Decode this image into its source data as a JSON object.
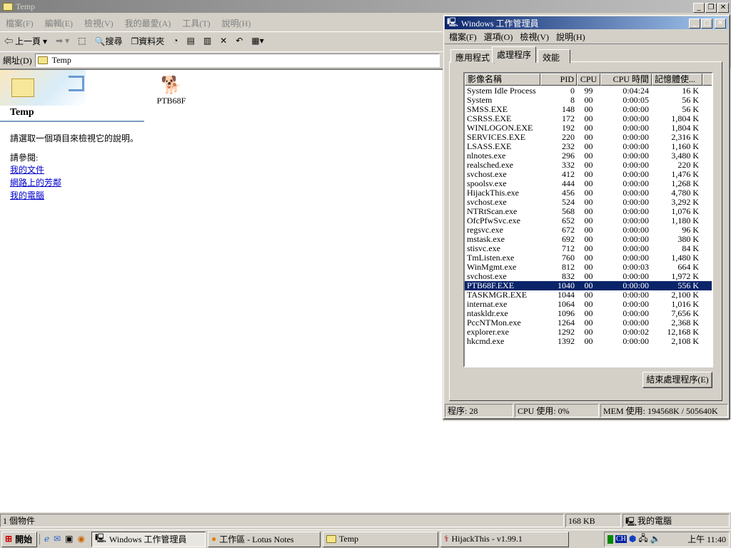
{
  "explorer": {
    "title": "Temp",
    "menu": [
      "檔案(F)",
      "編輯(E)",
      "檢視(V)",
      "我的最愛(A)",
      "工具(T)",
      "說明(H)"
    ],
    "toolbar": {
      "back": "上一頁",
      "search": "搜尋",
      "folders": "資料夾"
    },
    "address": {
      "label": "網址(D)",
      "value": "Temp"
    },
    "side": {
      "title": "Temp",
      "hint": "請選取一個項目來檢視它的說明。",
      "see_also": "請參閱:",
      "links": [
        "我的文件",
        "網路上的芳鄰",
        "我的電腦"
      ]
    },
    "file": {
      "name": "PTB68F"
    },
    "status": {
      "count": "1 個物件",
      "size": "168 KB",
      "zone": "我的電腦"
    }
  },
  "taskmgr": {
    "title": "Windows 工作管理員",
    "menu": [
      "檔案(F)",
      "選項(O)",
      "檢視(V)",
      "說明(H)"
    ],
    "tabs": [
      "應用程式",
      "處理程序",
      "效能"
    ],
    "columns": [
      "影像名稱",
      "PID",
      "CPU",
      "CPU 時間",
      "記憶體使..."
    ],
    "processes": [
      [
        "System Idle Process",
        "0",
        "99",
        "0:04:24",
        "16 K"
      ],
      [
        "System",
        "8",
        "00",
        "0:00:05",
        "56 K"
      ],
      [
        "SMSS.EXE",
        "148",
        "00",
        "0:00:00",
        "56 K"
      ],
      [
        "CSRSS.EXE",
        "172",
        "00",
        "0:00:00",
        "1,804 K"
      ],
      [
        "WINLOGON.EXE",
        "192",
        "00",
        "0:00:00",
        "1,804 K"
      ],
      [
        "SERVICES.EXE",
        "220",
        "00",
        "0:00:00",
        "2,316 K"
      ],
      [
        "LSASS.EXE",
        "232",
        "00",
        "0:00:00",
        "1,160 K"
      ],
      [
        "nlnotes.exe",
        "296",
        "00",
        "0:00:00",
        "3,480 K"
      ],
      [
        "realsched.exe",
        "332",
        "00",
        "0:00:00",
        "220 K"
      ],
      [
        "svchost.exe",
        "412",
        "00",
        "0:00:00",
        "1,476 K"
      ],
      [
        "spoolsv.exe",
        "444",
        "00",
        "0:00:00",
        "1,268 K"
      ],
      [
        "HijackThis.exe",
        "456",
        "00",
        "0:00:00",
        "4,780 K"
      ],
      [
        "svchost.exe",
        "524",
        "00",
        "0:00:00",
        "3,292 K"
      ],
      [
        "NTRtScan.exe",
        "568",
        "00",
        "0:00:00",
        "1,076 K"
      ],
      [
        "OfcPfwSvc.exe",
        "652",
        "00",
        "0:00:00",
        "1,180 K"
      ],
      [
        "regsvc.exe",
        "672",
        "00",
        "0:00:00",
        "96 K"
      ],
      [
        "mstask.exe",
        "692",
        "00",
        "0:00:00",
        "380 K"
      ],
      [
        "stisvc.exe",
        "712",
        "00",
        "0:00:00",
        "84 K"
      ],
      [
        "TmListen.exe",
        "760",
        "00",
        "0:00:00",
        "1,480 K"
      ],
      [
        "WinMgmt.exe",
        "812",
        "00",
        "0:00:03",
        "664 K"
      ],
      [
        "svchost.exe",
        "832",
        "00",
        "0:00:00",
        "1,972 K"
      ],
      [
        "PTB68F.EXE",
        "1040",
        "00",
        "0:00:00",
        "556 K"
      ],
      [
        "TASKMGR.EXE",
        "1044",
        "00",
        "0:00:00",
        "2,100 K"
      ],
      [
        "internat.exe",
        "1064",
        "00",
        "0:00:00",
        "1,016 K"
      ],
      [
        "ntaskldr.exe",
        "1096",
        "00",
        "0:00:00",
        "7,656 K"
      ],
      [
        "PccNTMon.exe",
        "1264",
        "00",
        "0:00:00",
        "2,368 K"
      ],
      [
        "explorer.exe",
        "1292",
        "00",
        "0:00:02",
        "12,168 K"
      ],
      [
        "hkcmd.exe",
        "1392",
        "00",
        "0:00:00",
        "2,108 K"
      ]
    ],
    "selected_index": 21,
    "end_button": "結束處理程序(E)",
    "status": {
      "procs": "程序: 28",
      "cpu": "CPU 使用: 0%",
      "mem": "MEM 使用: 194568K / 505640K"
    }
  },
  "taskbar": {
    "start": "開始",
    "buttons": [
      "Windows 工作管理員",
      "工作區 - Lotus Notes",
      "Temp",
      "HijackThis - v1.99.1"
    ],
    "ime": "CH",
    "clock": "上午 11:40"
  }
}
